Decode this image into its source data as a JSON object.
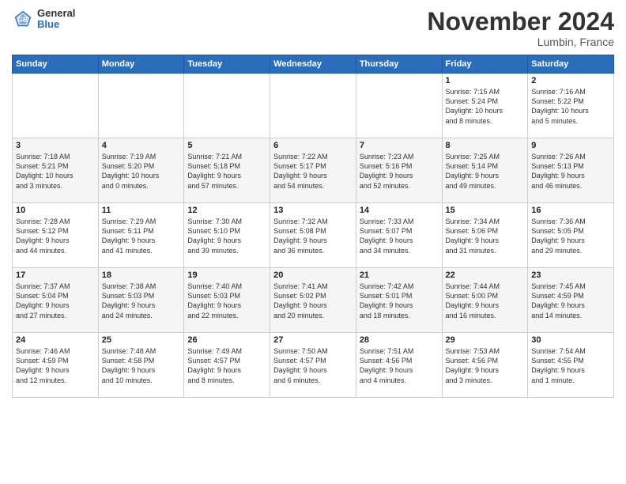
{
  "logo": {
    "general": "General",
    "blue": "Blue"
  },
  "title": "November 2024",
  "location": "Lumbin, France",
  "days_of_week": [
    "Sunday",
    "Monday",
    "Tuesday",
    "Wednesday",
    "Thursday",
    "Friday",
    "Saturday"
  ],
  "weeks": [
    [
      {
        "day": "",
        "info": ""
      },
      {
        "day": "",
        "info": ""
      },
      {
        "day": "",
        "info": ""
      },
      {
        "day": "",
        "info": ""
      },
      {
        "day": "",
        "info": ""
      },
      {
        "day": "1",
        "info": "Sunrise: 7:15 AM\nSunset: 5:24 PM\nDaylight: 10 hours\nand 8 minutes."
      },
      {
        "day": "2",
        "info": "Sunrise: 7:16 AM\nSunset: 5:22 PM\nDaylight: 10 hours\nand 5 minutes."
      }
    ],
    [
      {
        "day": "3",
        "info": "Sunrise: 7:18 AM\nSunset: 5:21 PM\nDaylight: 10 hours\nand 3 minutes."
      },
      {
        "day": "4",
        "info": "Sunrise: 7:19 AM\nSunset: 5:20 PM\nDaylight: 10 hours\nand 0 minutes."
      },
      {
        "day": "5",
        "info": "Sunrise: 7:21 AM\nSunset: 5:18 PM\nDaylight: 9 hours\nand 57 minutes."
      },
      {
        "day": "6",
        "info": "Sunrise: 7:22 AM\nSunset: 5:17 PM\nDaylight: 9 hours\nand 54 minutes."
      },
      {
        "day": "7",
        "info": "Sunrise: 7:23 AM\nSunset: 5:16 PM\nDaylight: 9 hours\nand 52 minutes."
      },
      {
        "day": "8",
        "info": "Sunrise: 7:25 AM\nSunset: 5:14 PM\nDaylight: 9 hours\nand 49 minutes."
      },
      {
        "day": "9",
        "info": "Sunrise: 7:26 AM\nSunset: 5:13 PM\nDaylight: 9 hours\nand 46 minutes."
      }
    ],
    [
      {
        "day": "10",
        "info": "Sunrise: 7:28 AM\nSunset: 5:12 PM\nDaylight: 9 hours\nand 44 minutes."
      },
      {
        "day": "11",
        "info": "Sunrise: 7:29 AM\nSunset: 5:11 PM\nDaylight: 9 hours\nand 41 minutes."
      },
      {
        "day": "12",
        "info": "Sunrise: 7:30 AM\nSunset: 5:10 PM\nDaylight: 9 hours\nand 39 minutes."
      },
      {
        "day": "13",
        "info": "Sunrise: 7:32 AM\nSunset: 5:08 PM\nDaylight: 9 hours\nand 36 minutes."
      },
      {
        "day": "14",
        "info": "Sunrise: 7:33 AM\nSunset: 5:07 PM\nDaylight: 9 hours\nand 34 minutes."
      },
      {
        "day": "15",
        "info": "Sunrise: 7:34 AM\nSunset: 5:06 PM\nDaylight: 9 hours\nand 31 minutes."
      },
      {
        "day": "16",
        "info": "Sunrise: 7:36 AM\nSunset: 5:05 PM\nDaylight: 9 hours\nand 29 minutes."
      }
    ],
    [
      {
        "day": "17",
        "info": "Sunrise: 7:37 AM\nSunset: 5:04 PM\nDaylight: 9 hours\nand 27 minutes."
      },
      {
        "day": "18",
        "info": "Sunrise: 7:38 AM\nSunset: 5:03 PM\nDaylight: 9 hours\nand 24 minutes."
      },
      {
        "day": "19",
        "info": "Sunrise: 7:40 AM\nSunset: 5:03 PM\nDaylight: 9 hours\nand 22 minutes."
      },
      {
        "day": "20",
        "info": "Sunrise: 7:41 AM\nSunset: 5:02 PM\nDaylight: 9 hours\nand 20 minutes."
      },
      {
        "day": "21",
        "info": "Sunrise: 7:42 AM\nSunset: 5:01 PM\nDaylight: 9 hours\nand 18 minutes."
      },
      {
        "day": "22",
        "info": "Sunrise: 7:44 AM\nSunset: 5:00 PM\nDaylight: 9 hours\nand 16 minutes."
      },
      {
        "day": "23",
        "info": "Sunrise: 7:45 AM\nSunset: 4:59 PM\nDaylight: 9 hours\nand 14 minutes."
      }
    ],
    [
      {
        "day": "24",
        "info": "Sunrise: 7:46 AM\nSunset: 4:59 PM\nDaylight: 9 hours\nand 12 minutes."
      },
      {
        "day": "25",
        "info": "Sunrise: 7:48 AM\nSunset: 4:58 PM\nDaylight: 9 hours\nand 10 minutes."
      },
      {
        "day": "26",
        "info": "Sunrise: 7:49 AM\nSunset: 4:57 PM\nDaylight: 9 hours\nand 8 minutes."
      },
      {
        "day": "27",
        "info": "Sunrise: 7:50 AM\nSunset: 4:57 PM\nDaylight: 9 hours\nand 6 minutes."
      },
      {
        "day": "28",
        "info": "Sunrise: 7:51 AM\nSunset: 4:56 PM\nDaylight: 9 hours\nand 4 minutes."
      },
      {
        "day": "29",
        "info": "Sunrise: 7:53 AM\nSunset: 4:56 PM\nDaylight: 9 hours\nand 3 minutes."
      },
      {
        "day": "30",
        "info": "Sunrise: 7:54 AM\nSunset: 4:55 PM\nDaylight: 9 hours\nand 1 minute."
      }
    ]
  ]
}
